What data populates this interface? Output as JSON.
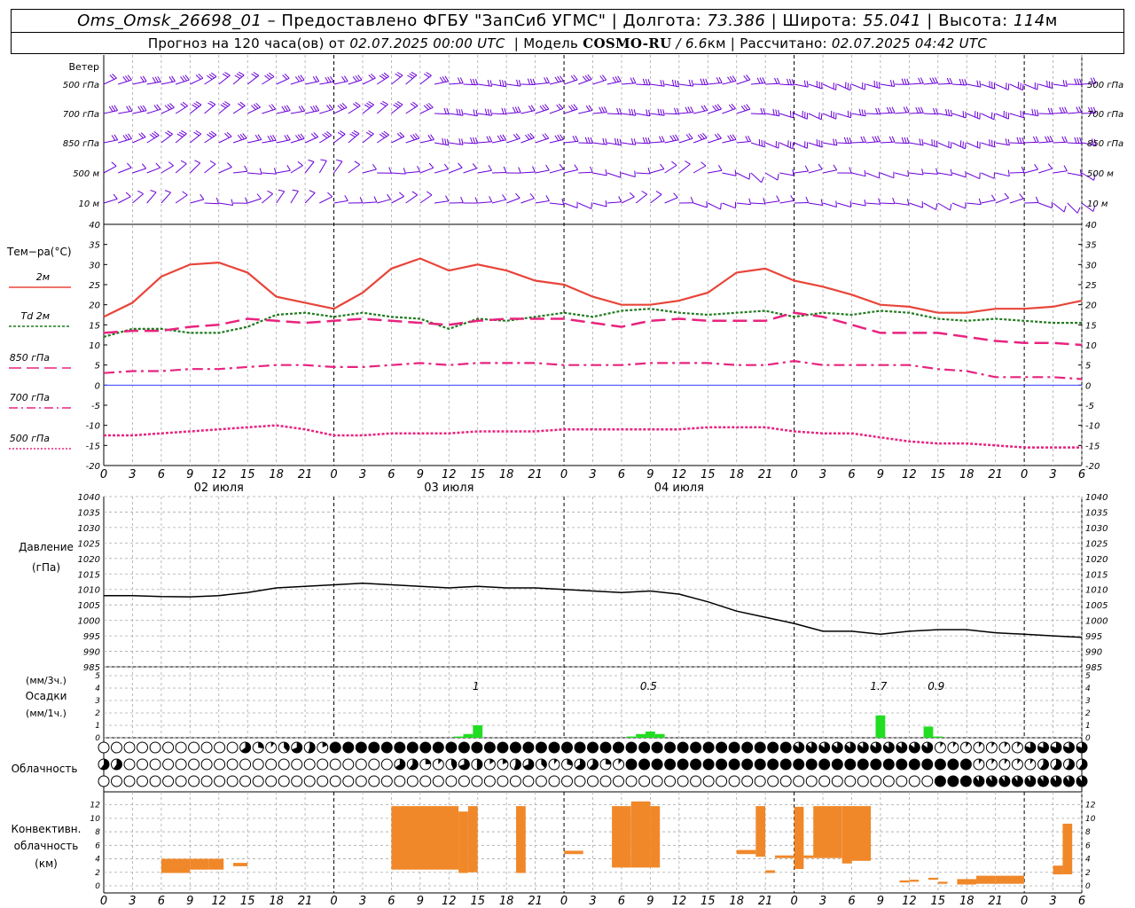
{
  "header": {
    "station": "Oms_Omsk_26698_01",
    "dash": "–",
    "provided_by": "Предоставлено ФГБУ \"ЗапСиб УГМС\"",
    "lon_label": "Долгота:",
    "lon_value": "73.386",
    "lat_label": "Широта:",
    "lat_value": "55.041",
    "alt_label": "Высота:",
    "alt_value": "114",
    "alt_unit": "м",
    "forecast_label": "Прогноз на 120 часа(ов) от",
    "forecast_from": "02.07.2025 00:00 UTC",
    "model_label": "Модель",
    "model_name": "COSMO-RU",
    "model_res": "/ 6.6",
    "model_res_unit": "км",
    "calc_label": "Рассчитано:",
    "calc_time": "02.07.2025 04:42 UTC"
  },
  "wind_panel": {
    "title": "Ветер",
    "levels": [
      "500 гПа",
      "700 гПа",
      "850 гПа",
      "500 м",
      "10  м"
    ]
  },
  "temp_panel": {
    "title": "Тем−ра(°C)",
    "legend": [
      {
        "label": "2м",
        "color": "#e8453a",
        "dash": "solid"
      },
      {
        "label": "Td  2м",
        "color": "#1f7a1f",
        "dash": "dots"
      },
      {
        "label": "850 гПа",
        "color": "#e8237f",
        "dash": "long"
      },
      {
        "label": "700 гПа",
        "color": "#e8237f",
        "dash": "dashdot"
      },
      {
        "label": "500 гПа",
        "color": "#e8237f",
        "dash": "dotted"
      }
    ],
    "yticks": [
      40,
      35,
      30,
      25,
      20,
      15,
      10,
      5,
      0,
      -5,
      -10,
      -15,
      -20
    ],
    "date_labels": [
      "02 июля",
      "03 июля",
      "04 июля"
    ]
  },
  "pressure_panel": {
    "title": "Давление",
    "unit": "(гПа)",
    "yticks": [
      1040,
      1035,
      1030,
      1025,
      1020,
      1015,
      1010,
      1005,
      1000,
      995,
      990,
      985
    ]
  },
  "precip_panel": {
    "unit3": "(мм/3ч.)",
    "title": "Осадки",
    "unit1": "(мм/1ч.)",
    "yticks": [
      5,
      4,
      3,
      2,
      1,
      0
    ],
    "totals": [
      {
        "hour": 39,
        "label": "1"
      },
      {
        "hour": 57,
        "label": "0.5"
      },
      {
        "hour": 81,
        "label": "1.7"
      },
      {
        "hour": 87,
        "label": "0.9"
      }
    ]
  },
  "cloud_panel": {
    "title": "Облачность"
  },
  "conv_panel": {
    "title1": "Конвективн.",
    "title2": "облачность",
    "unit": "(км)",
    "yticks": [
      12,
      10,
      8,
      6,
      4,
      2,
      0
    ]
  },
  "x_axis": {
    "hour_labels": [
      "0",
      "3",
      "6",
      "9",
      "12",
      "15",
      "18",
      "21",
      "0",
      "3",
      "6",
      "9",
      "12",
      "15",
      "18",
      "21",
      "0",
      "3",
      "6",
      "9",
      "12",
      "15",
      "18",
      "21",
      "0",
      "3",
      "6",
      "9",
      "12",
      "15",
      "18",
      "21",
      "0",
      "3",
      "6"
    ]
  },
  "colors": {
    "wind": "#6a00d9",
    "t2m": "#e8453a",
    "td2m": "#1f7a1f",
    "upper": "#e8237f",
    "zero_line": "#3040ff",
    "precip": "#22dd22",
    "conv": "#f0882a"
  },
  "chart_data": [
    {
      "type": "line",
      "panel": "temperature",
      "x_hours": [
        0,
        3,
        6,
        9,
        12,
        15,
        18,
        21,
        24,
        27,
        30,
        33,
        36,
        39,
        42,
        45,
        48,
        51,
        54,
        57,
        60,
        63,
        66,
        69,
        72,
        75,
        78,
        81,
        84,
        87,
        90,
        93,
        96,
        99,
        102
      ],
      "ylim": [
        -20,
        40
      ],
      "series": [
        {
          "name": "2м",
          "values": [
            17,
            20.5,
            27,
            30,
            30.5,
            28,
            22,
            20.5,
            19,
            23,
            29,
            31.5,
            28.5,
            30,
            28.5,
            26,
            25,
            22,
            20,
            20,
            21,
            23,
            28,
            29,
            26,
            24.5,
            22.5,
            20,
            19.5,
            18,
            18,
            19,
            19,
            19.5,
            21
          ]
        },
        {
          "name": "Td  2м",
          "values": [
            12,
            14,
            14,
            13,
            13,
            14.5,
            17.5,
            18,
            17,
            18,
            17,
            16.5,
            14,
            16.5,
            16,
            17,
            18,
            17,
            18.5,
            19,
            18,
            17.5,
            18,
            18.5,
            17,
            18,
            17.5,
            18.5,
            18,
            16.5,
            16,
            16.5,
            16,
            15.5,
            15.5
          ]
        },
        {
          "name": "850 гПа",
          "values": [
            13,
            13.5,
            13.5,
            14.5,
            15,
            16.5,
            16,
            15.5,
            16,
            16.5,
            16,
            15.5,
            15,
            16,
            16.5,
            16.5,
            16.5,
            15.5,
            14.5,
            16,
            16.5,
            16,
            16,
            16,
            18,
            17,
            15,
            13,
            13,
            13,
            12,
            11,
            10.5,
            10.5,
            10
          ]
        },
        {
          "name": "700 гПа",
          "values": [
            3,
            3.5,
            3.5,
            4,
            4,
            4.5,
            5,
            5,
            4.5,
            4.5,
            5,
            5.5,
            5,
            5.5,
            5.5,
            5.5,
            5,
            5,
            5,
            5.5,
            5.5,
            5.5,
            5,
            5,
            6,
            5,
            5,
            5,
            5,
            4,
            3.5,
            2,
            2,
            2,
            1.5
          ]
        },
        {
          "name": "500 гПа",
          "values": [
            -12.5,
            -12.5,
            -12,
            -11.5,
            -11,
            -10.5,
            -10,
            -11,
            -12.5,
            -12.5,
            -12,
            -12,
            -12,
            -11.5,
            -11.5,
            -11.5,
            -11,
            -11,
            -11,
            -11,
            -11,
            -10.5,
            -10.5,
            -10.5,
            -11.5,
            -12,
            -12,
            -13,
            -14,
            -14.5,
            -14.5,
            -15,
            -15.5,
            -15.5,
            -15.5
          ]
        }
      ]
    },
    {
      "type": "line",
      "panel": "pressure",
      "x_hours": [
        0,
        3,
        6,
        9,
        12,
        15,
        18,
        21,
        24,
        27,
        30,
        33,
        36,
        39,
        42,
        45,
        48,
        51,
        54,
        57,
        60,
        63,
        66,
        69,
        72,
        75,
        78,
        81,
        84,
        87,
        90,
        93,
        96,
        99,
        102
      ],
      "ylim": [
        985,
        1040
      ],
      "series": [
        {
          "name": "Давление",
          "values": [
            1008,
            1008,
            1007.7,
            1007.6,
            1008,
            1009,
            1010.5,
            1011,
            1011.5,
            1012,
            1011.5,
            1011,
            1010.5,
            1011,
            1010.5,
            1010.5,
            1010,
            1009.5,
            1009,
            1009.5,
            1008.5,
            1006,
            1003,
            1001,
            999,
            996.5,
            996.5,
            995.5,
            996.5,
            997,
            997,
            996,
            995.5,
            995,
            994.5
          ]
        }
      ]
    },
    {
      "type": "bar",
      "panel": "precipitation",
      "ylim": [
        0,
        5
      ],
      "x_hours": [
        37,
        38,
        39,
        55,
        56,
        57,
        58,
        81,
        86,
        87
      ],
      "values": [
        0.1,
        0.3,
        1.0,
        0.1,
        0.3,
        0.5,
        0.3,
        1.8,
        0.9,
        0.1
      ]
    },
    {
      "type": "bar",
      "panel": "convective_cloud",
      "ylim": [
        0,
        13
      ],
      "bars": [
        {
          "h0": 6,
          "h1": 9,
          "bottom": 1.9,
          "top": 4.0
        },
        {
          "h0": 9,
          "h1": 11,
          "bottom": 2.4,
          "top": 4.0
        },
        {
          "h0": 11,
          "h1": 12.5,
          "bottom": 2.4,
          "top": 4.0
        },
        {
          "h0": 13.5,
          "h1": 15,
          "bottom": 2.9,
          "top": 3.4
        },
        {
          "h0": 30,
          "h1": 37,
          "bottom": 2.4,
          "top": 11.8
        },
        {
          "h0": 37,
          "h1": 38,
          "bottom": 1.9,
          "top": 11.0
        },
        {
          "h0": 38,
          "h1": 39,
          "bottom": 2.0,
          "top": 11.8
        },
        {
          "h0": 43,
          "h1": 44,
          "bottom": 1.9,
          "top": 11.8
        },
        {
          "h0": 48,
          "h1": 50,
          "bottom": 4.7,
          "top": 5.2
        },
        {
          "h0": 53,
          "h1": 55,
          "bottom": 2.7,
          "top": 11.8
        },
        {
          "h0": 55,
          "h1": 57,
          "bottom": 2.7,
          "top": 12.5
        },
        {
          "h0": 57,
          "h1": 58,
          "bottom": 2.7,
          "top": 11.8
        },
        {
          "h0": 66,
          "h1": 68,
          "bottom": 4.7,
          "top": 5.3
        },
        {
          "h0": 68,
          "h1": 69,
          "bottom": 4.3,
          "top": 11.8
        },
        {
          "h0": 69,
          "h1": 70,
          "bottom": 1.9,
          "top": 2.3
        },
        {
          "h0": 70,
          "h1": 72,
          "bottom": 4.1,
          "top": 4.5
        },
        {
          "h0": 72,
          "h1": 73,
          "bottom": 2.5,
          "top": 11.7
        },
        {
          "h0": 73,
          "h1": 74,
          "bottom": 4.1,
          "top": 4.5
        },
        {
          "h0": 74,
          "h1": 77,
          "bottom": 4.1,
          "top": 11.8
        },
        {
          "h0": 77,
          "h1": 78,
          "bottom": 3.3,
          "top": 11.8
        },
        {
          "h0": 78,
          "h1": 80,
          "bottom": 3.7,
          "top": 11.8
        },
        {
          "h0": 83,
          "h1": 84,
          "bottom": 0.5,
          "top": 0.8
        },
        {
          "h0": 84,
          "h1": 85,
          "bottom": 0.6,
          "top": 0.9
        },
        {
          "h0": 86,
          "h1": 87,
          "bottom": 0.9,
          "top": 1.2
        },
        {
          "h0": 87,
          "h1": 88,
          "bottom": 0.3,
          "top": 0.6
        },
        {
          "h0": 89,
          "h1": 91,
          "bottom": 0.2,
          "top": 1.0
        },
        {
          "h0": 91,
          "h1": 93,
          "bottom": 0.3,
          "top": 1.5
        },
        {
          "h0": 93,
          "h1": 96,
          "bottom": 0.3,
          "top": 1.5
        },
        {
          "h0": 99,
          "h1": 100,
          "bottom": 1.7,
          "top": 3.0
        },
        {
          "h0": 100,
          "h1": 101,
          "bottom": 1.7,
          "top": 9.2
        }
      ]
    }
  ]
}
